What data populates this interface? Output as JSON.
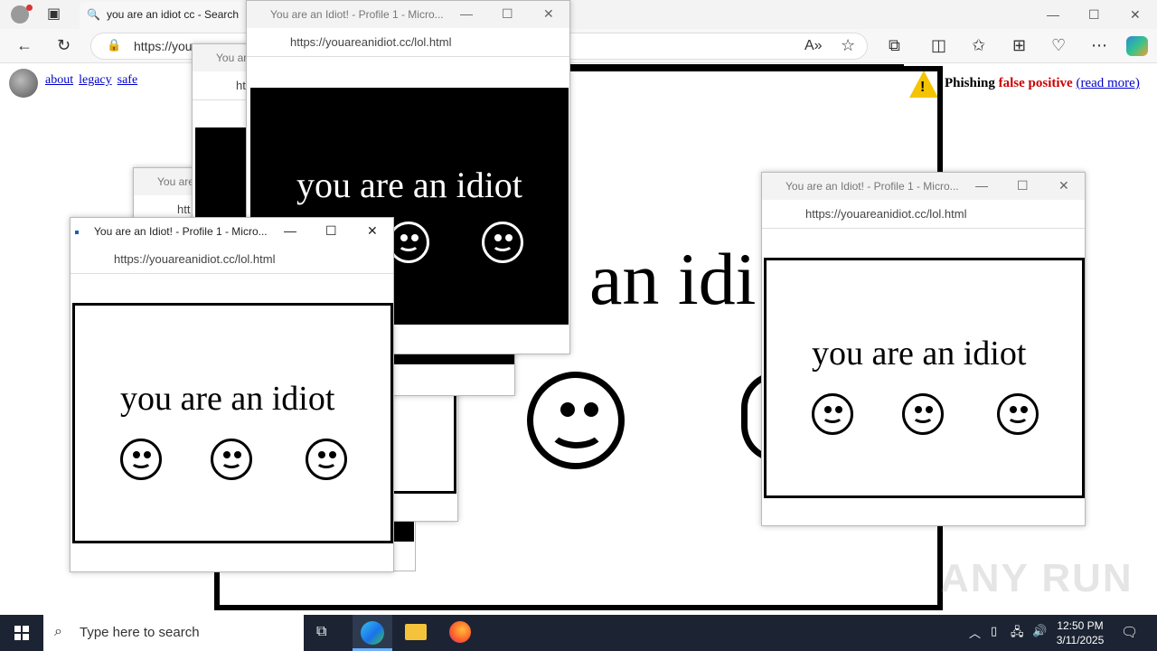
{
  "browser": {
    "tab_title": "you are an idiot cc - Search",
    "address": "https://you",
    "min": "—",
    "max": "☐",
    "close": "✕"
  },
  "page": {
    "links": [
      "about",
      "legacy",
      "safe"
    ],
    "phishing_word": "Phishing",
    "false_positive": "false positive",
    "read_more": "(read more)",
    "big_text": "an idi"
  },
  "popups": {
    "title": "You are an Idiot! - Profile 1 - Micro...",
    "title_short": "You ar",
    "title_short2": "You are",
    "url": "https://youareanidiot.cc/lol.html",
    "url_short": "htt",
    "message": "you are an idiot"
  },
  "taskbar": {
    "search_placeholder": "Type here to search",
    "time": "12:50 PM",
    "date": "3/11/2025"
  },
  "watermark": "ANY RUN"
}
